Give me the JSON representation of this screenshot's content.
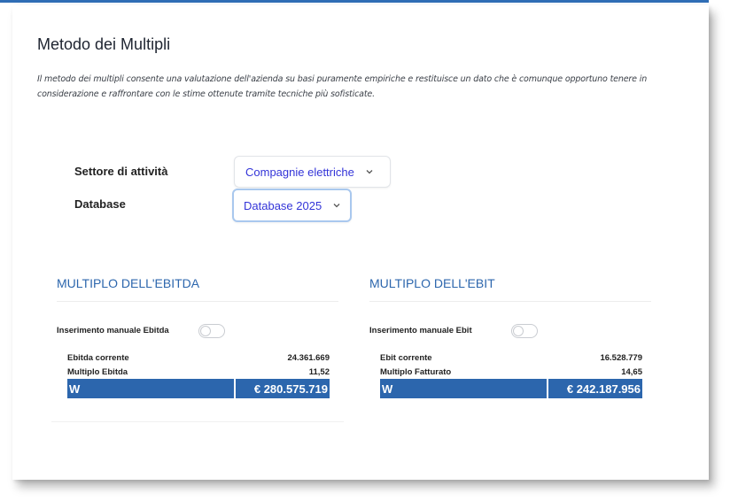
{
  "header": {
    "title": "Metodo dei Multipli",
    "description": "Il metodo dei multipli consente una valutazione dell'azienda su basi puramente empiriche e restituisce un dato che è comunque opportuno tenere in considerazione e raffrontare con le stime ottenute tramite tecniche più sofisticate."
  },
  "form": {
    "sector_label": "Settore di attività",
    "sector_value": "Compagnie elettriche",
    "database_label": "Database",
    "database_value": "Database 2025"
  },
  "ebitda": {
    "title": "MULTIPLO DELL'EBITDA",
    "toggle_label": "Inserimento manuale Ebitda",
    "toggle_on": false,
    "row1_label": "Ebitda corrente",
    "row1_value": "24.361.669",
    "row2_label": "Multiplo Ebitda",
    "row2_value": "11,52",
    "total_label": "W",
    "total_value": "€ 280.575.719"
  },
  "ebit": {
    "title": "MULTIPLO DELL'EBIT",
    "toggle_label": "Inserimento manuale Ebit",
    "toggle_on": false,
    "row1_label": "Ebit corrente",
    "row1_value": "16.528.779",
    "row2_label": "Multiplo Fatturato",
    "row2_value": "14,65",
    "total_label": "W",
    "total_value": "€ 242.187.956"
  },
  "colors": {
    "accent": "#2c66ad",
    "select_text": "#3334d8"
  }
}
